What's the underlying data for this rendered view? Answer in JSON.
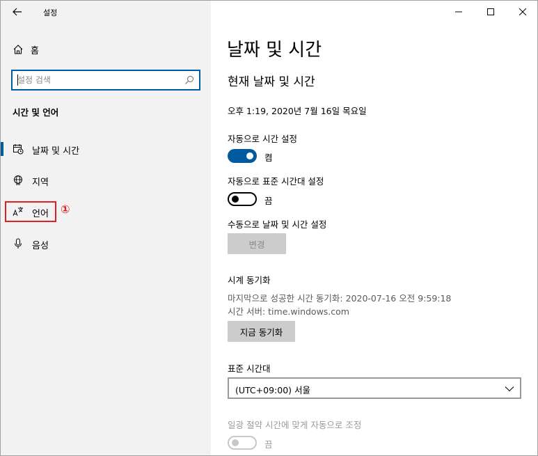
{
  "app": {
    "title": "설정"
  },
  "sidebar": {
    "home_label": "홈",
    "search_placeholder": "설정 검색",
    "section_title": "시간 및 언어",
    "items": [
      {
        "label": "날짜 및 시간",
        "icon": "calendar-clock-icon",
        "active": true
      },
      {
        "label": "지역",
        "icon": "globe-icon",
        "active": false
      },
      {
        "label": "언어",
        "icon": "language-icon",
        "active": false
      },
      {
        "label": "음성",
        "icon": "microphone-icon",
        "active": false
      }
    ],
    "annotation": "①"
  },
  "main": {
    "page_title": "날짜 및 시간",
    "subtitle": "현재 날짜 및 시간",
    "current_time": "오후 1:19, 2020년 7월 16일 목요일",
    "auto_time": {
      "label": "자동으로 시간 설정",
      "state": "켬",
      "on": true
    },
    "auto_timezone": {
      "label": "자동으로 표준 시간대 설정",
      "state": "끔",
      "on": false
    },
    "manual": {
      "label": "수동으로 날짜 및 시간 설정",
      "button": "변경"
    },
    "sync": {
      "header": "시계 동기화",
      "last_sync": "마지막으로 성공한 시간 동기화: 2020-07-16 오전 9:59:18",
      "server": "시간 서버: time.windows.com",
      "button": "지금 동기화"
    },
    "timezone": {
      "label": "표준 시간대",
      "selected": "(UTC+09:00) 서울"
    },
    "dst": {
      "label": "일광 절약 시간에 맞게 자동으로 조정",
      "state": "끔",
      "disabled": true
    }
  },
  "colors": {
    "accent": "#005a9e",
    "highlight": "#e02020",
    "sidebar_bg": "#f2f2f2"
  }
}
